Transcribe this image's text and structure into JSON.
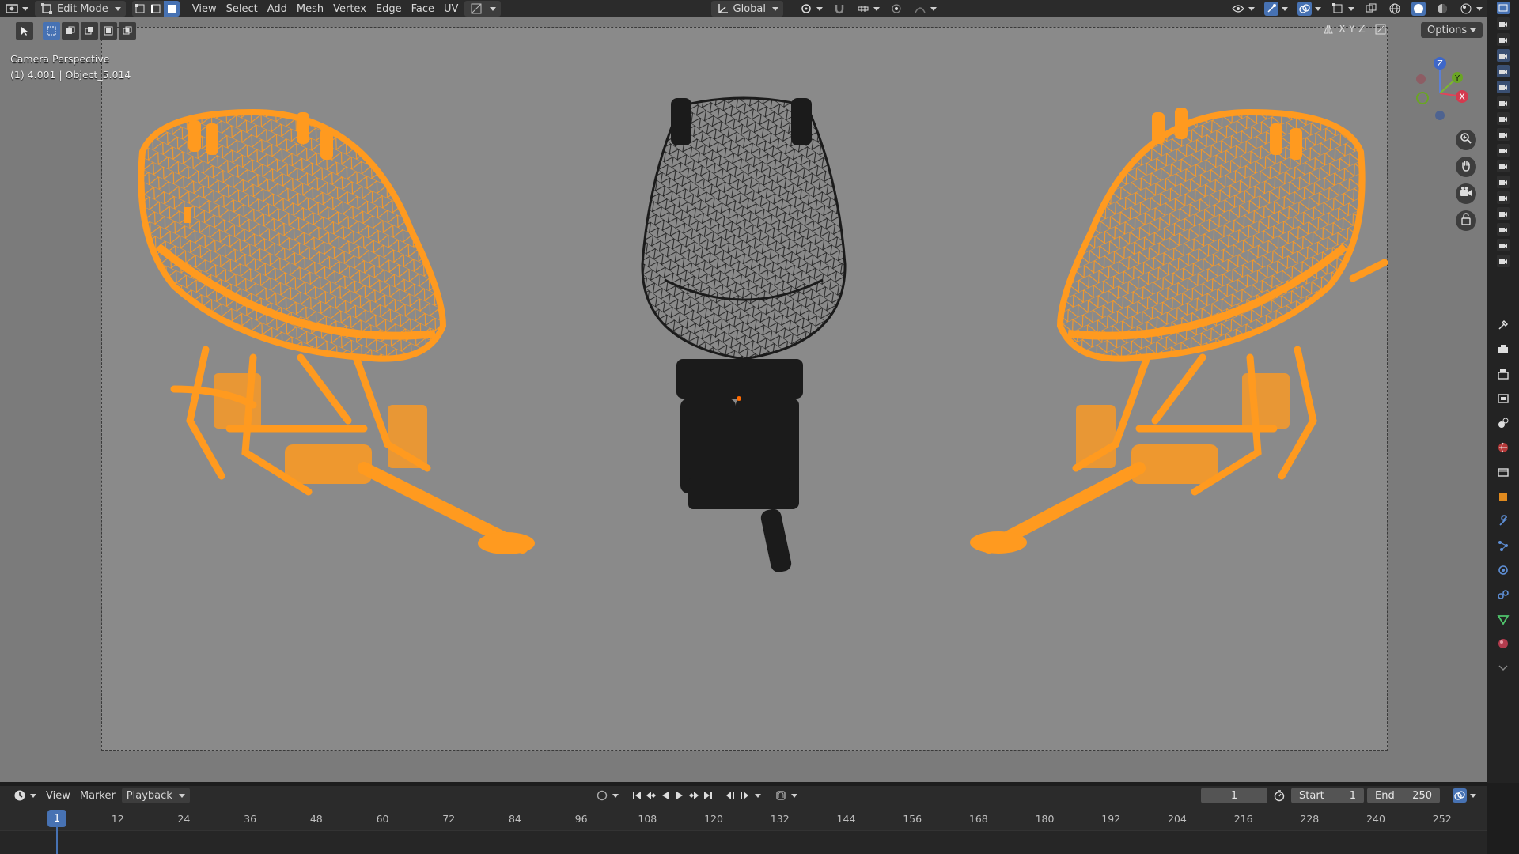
{
  "header": {
    "mode_label": "Edit Mode",
    "menus": [
      "View",
      "Select",
      "Add",
      "Mesh",
      "Vertex",
      "Edge",
      "Face",
      "UV"
    ],
    "transform_orientation": "Global"
  },
  "viewport": {
    "overlay_line1": "Camera Perspective",
    "overlay_line2": "(1) 4.001 | Object_5.014",
    "axis_x": "X",
    "axis_y": "Y",
    "axis_z": "Z",
    "options_label": "Options",
    "gizmo": {
      "z": "Z",
      "y": "Y",
      "x": "X"
    }
  },
  "timeline": {
    "menus": [
      "View",
      "Marker"
    ],
    "playback_label": "Playback",
    "current_frame": "1",
    "start_label": "Start",
    "start_value": "1",
    "end_label": "End",
    "end_value": "250",
    "ticks": [
      "1",
      "12",
      "24",
      "36",
      "48",
      "60",
      "72",
      "84",
      "96",
      "108",
      "120",
      "132",
      "144",
      "156",
      "168",
      "180",
      "192",
      "204",
      "216",
      "228",
      "240",
      "252"
    ]
  },
  "colors": {
    "accent": "#4772b3",
    "selected_mesh": "#ff9a1f",
    "unselected_mesh": "#1b1b1b"
  }
}
